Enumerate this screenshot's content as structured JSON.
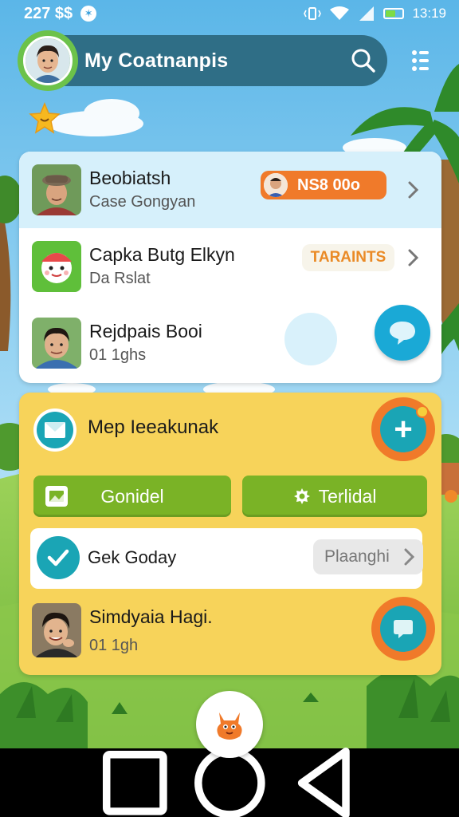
{
  "status_bar": {
    "time": "227 $$",
    "battery_text": "13:19"
  },
  "header": {
    "title": "My Coatnanpis"
  },
  "contacts": [
    {
      "name": "Beobiatsh",
      "subtitle": "Case Gongyan",
      "badge": "NS8 00o"
    },
    {
      "name": "Capka Butg Elkyn",
      "subtitle": "Da Rslat",
      "badge": "TARAINTS"
    },
    {
      "name": "Rejdpais Booi",
      "subtitle": "01 1ghs"
    }
  ],
  "panel": {
    "title": "Mep Ieeakunak",
    "button_left": "Gonidel",
    "button_right": "Terlidal",
    "task_label": "Gek Goday",
    "task_pill": "Plaanghi",
    "person_name": "Simdyaia Hagi.",
    "person_sub": "01 1gh"
  },
  "colors": {
    "header_bg": "#2f6e86",
    "accent_orange": "#f07a2a",
    "accent_teal": "#1aa5b5",
    "accent_green": "#7ab326",
    "panel_yellow": "#f7d35a"
  }
}
